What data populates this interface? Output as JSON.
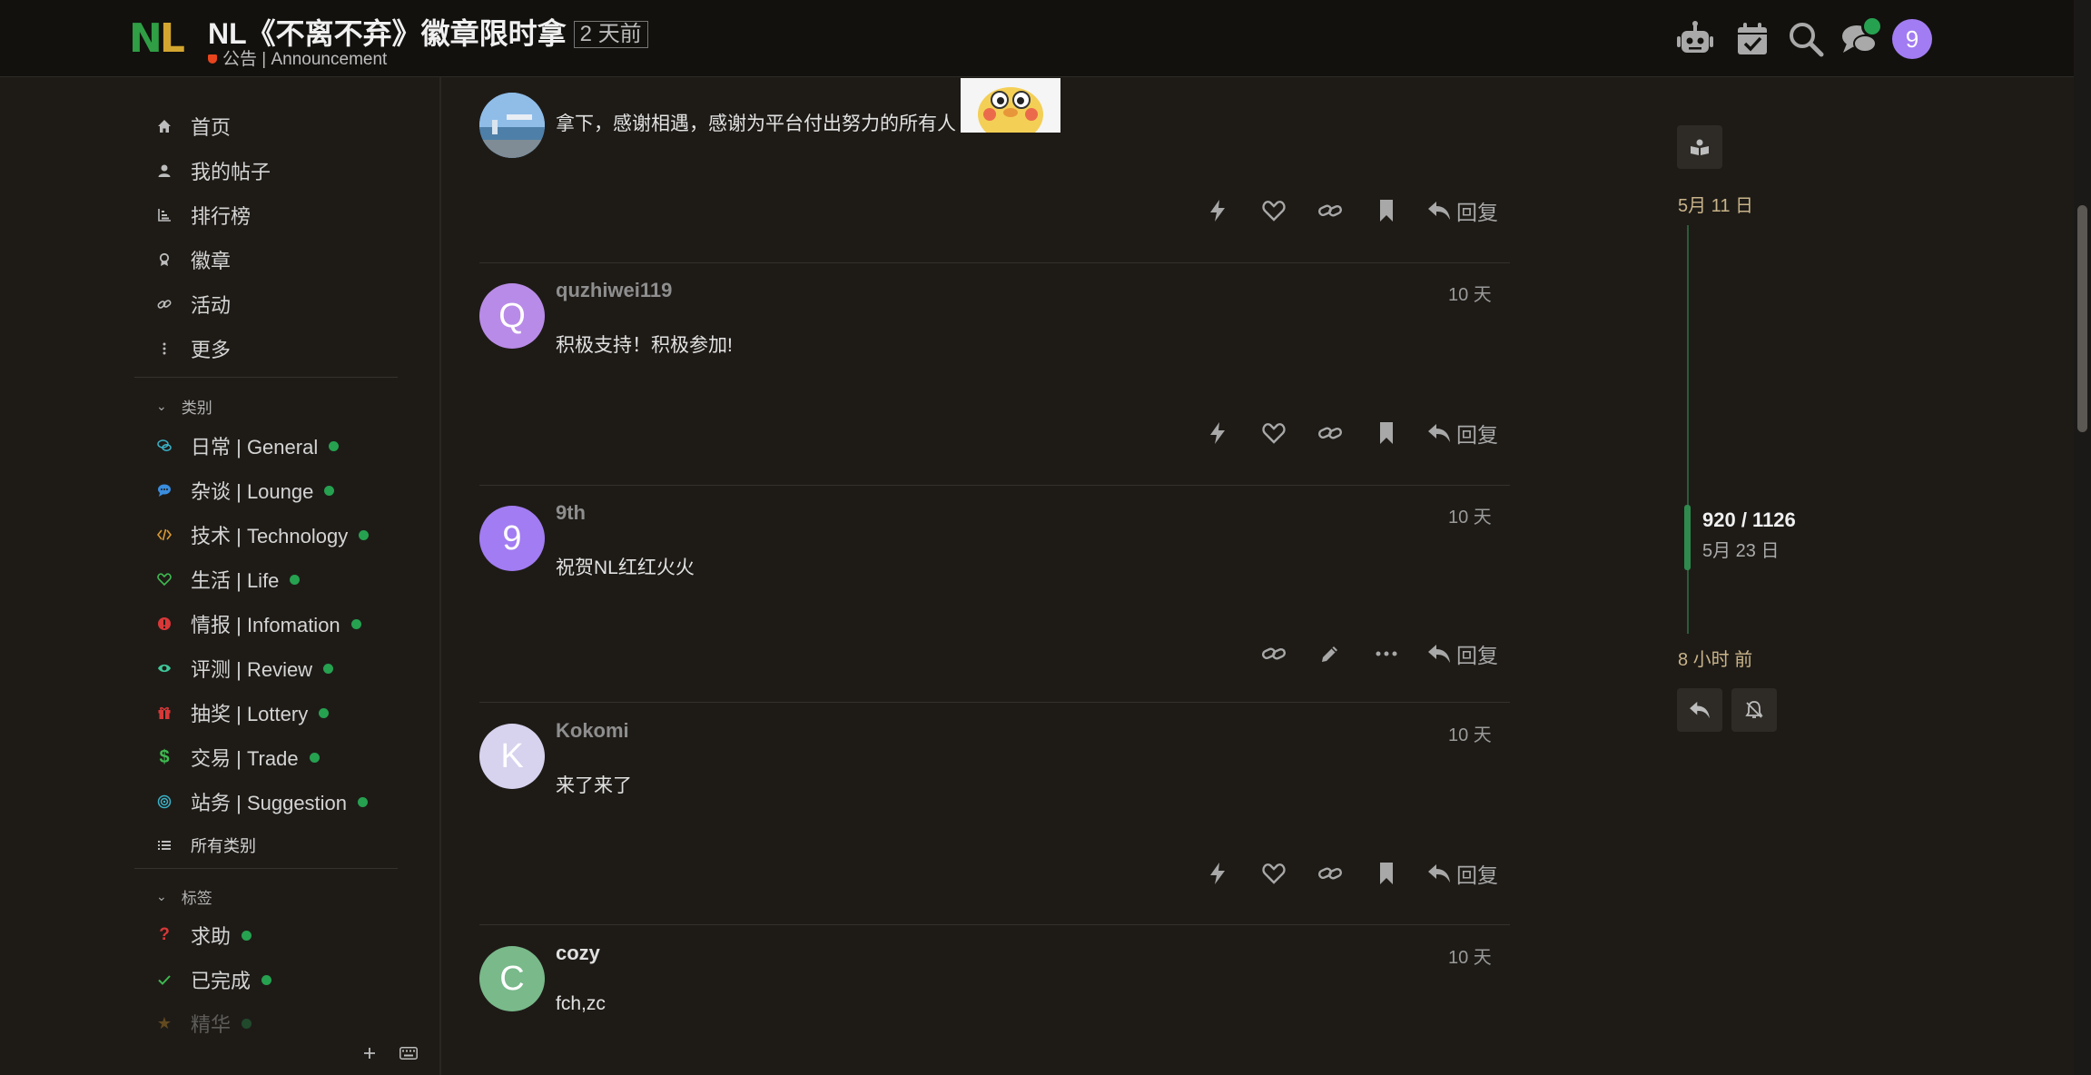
{
  "header": {
    "logo_text": "NL",
    "title": "NL《不离不弃》徽章限时拿",
    "age_badge": "2 天前",
    "category": "公告 | Announcement",
    "user_avatar_letter": "9"
  },
  "sidebar": {
    "nav": [
      {
        "label": "首页",
        "icon": "home-icon"
      },
      {
        "label": "我的帖子",
        "icon": "user-icon"
      },
      {
        "label": "排行榜",
        "icon": "chart-icon"
      },
      {
        "label": "徽章",
        "icon": "badge-icon"
      },
      {
        "label": "活动",
        "icon": "link-icon"
      },
      {
        "label": "更多",
        "icon": "more-icon"
      }
    ],
    "categories_heading": "类别",
    "categories": [
      {
        "label": "日常 | General",
        "icon": "chat-bubbles-icon",
        "color": "#3ab2c7"
      },
      {
        "label": "杂谈 | Lounge",
        "icon": "speech-icon",
        "color": "#3a8dde"
      },
      {
        "label": "技术 | Technology",
        "icon": "code-icon",
        "color": "#d99a34"
      },
      {
        "label": "生活 | Life",
        "icon": "heart-icon",
        "color": "#3fb950"
      },
      {
        "label": "情报 | Infomation",
        "icon": "info-icon",
        "color": "#d93838"
      },
      {
        "label": "评测 | Review",
        "icon": "eye-icon",
        "color": "#3fc79a"
      },
      {
        "label": "抽奖 | Lottery",
        "icon": "gift-icon",
        "color": "#d93838"
      },
      {
        "label": "交易 | Trade",
        "icon": "dollar-icon",
        "color": "#3fb950"
      },
      {
        "label": "站务 | Suggestion",
        "icon": "target-icon",
        "color": "#3ab2c7"
      }
    ],
    "all_categories": "所有类别",
    "tags_heading": "标签",
    "tags": [
      {
        "label": "求助",
        "icon": "question-icon",
        "color": "#d93838"
      },
      {
        "label": "已完成",
        "icon": "check-icon",
        "color": "#3fb950"
      },
      {
        "label": "精华",
        "icon": "star-icon",
        "color": "#e0a030"
      }
    ]
  },
  "posts": [
    {
      "username": "",
      "time": "",
      "body": "拿下，感谢相遇，感谢为平台付出努力的所有人",
      "avatar_letter": "",
      "avatar_color": "#5b8fc9"
    },
    {
      "username": "quzhiwei119",
      "time": "10 天",
      "body": "积极支持！积极参加!",
      "avatar_letter": "Q",
      "avatar_color": "#b98be8"
    },
    {
      "username": "9th",
      "time": "10 天",
      "body": "祝贺NL红红火火",
      "avatar_letter": "9",
      "avatar_color": "#a27cf2"
    },
    {
      "username": "Kokomi",
      "time": "10 天",
      "body": "来了来了",
      "avatar_letter": "K",
      "avatar_color": "#d7d2ee"
    },
    {
      "username": "cozy",
      "time": "10 天",
      "body": "fch,zc",
      "avatar_letter": "C",
      "avatar_color": "#79b98a"
    }
  ],
  "actions": {
    "reply_label": "回复"
  },
  "timeline": {
    "start_date": "5月 11 日",
    "position": "920 / 1126",
    "position_date": "5月 23 日",
    "end_label": "8 小时 前"
  },
  "colors": {
    "background": "#1e1b17",
    "header": "#12110e",
    "accent_green": "#26a150",
    "timeline_green": "#2f8a4d"
  }
}
